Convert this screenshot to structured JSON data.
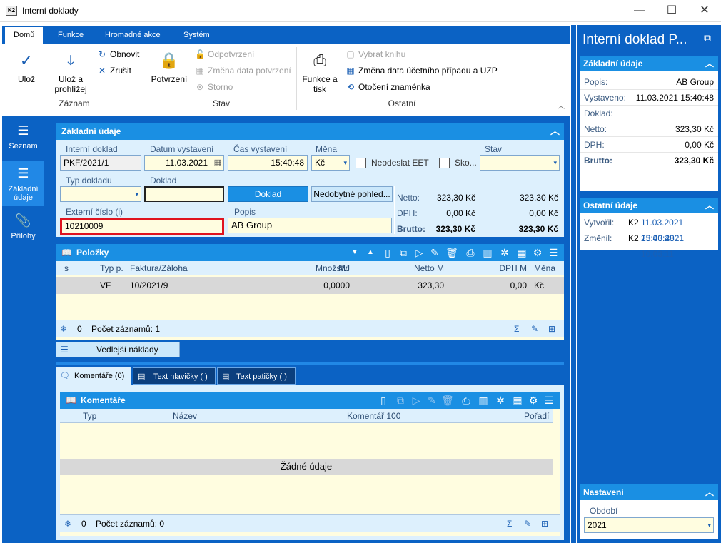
{
  "window": {
    "title": "Interní doklady",
    "icon_text": "K2"
  },
  "ribbon": {
    "tabs": [
      "Domů",
      "Funkce",
      "Hromadné akce",
      "Systém"
    ],
    "active_tab": "Domů",
    "zaznam": {
      "uloz": "Ulož",
      "uloz_prohlizej_1": "Ulož a",
      "uloz_prohlizej_2": "prohlížej",
      "obnovit": "Obnovit",
      "zrusit": "Zrušit",
      "label": "Záznam"
    },
    "stav": {
      "potvrzeni": "Potvrzení",
      "odpotvrzeni": "Odpotvrzení",
      "zmena_data": "Změna data potvrzení",
      "storno": "Storno",
      "label": "Stav"
    },
    "ostatni": {
      "funkce_tisk_1": "Funkce a",
      "funkce_tisk_2": "tisk",
      "vybrat_knihu": "Vybrat knihu",
      "zmena_data_uzp": "Změna data účetního případu a UZP",
      "otoceni": "Otočení znaménka",
      "label": "Ostatní"
    }
  },
  "leftnav": {
    "seznam": "Seznam",
    "zakladni_1": "Základní",
    "zakladni_2": "údaje",
    "prilohy": "Přílohy"
  },
  "basic": {
    "title": "Základní údaje",
    "interni_doklad_label": "Interní doklad",
    "interni_doklad": "PKF/2021/1",
    "datum_label": "Datum vystavení",
    "datum": "11.03.2021",
    "cas_label": "Čas vystavení",
    "cas": "15:40:48",
    "mena_label": "Měna",
    "mena": "Kč",
    "neodeslat": "Neodeslat EET",
    "sko": "Sko...",
    "stav_label": "Stav",
    "typ_label": "Typ dokladu",
    "doklad_label": "Doklad",
    "doklad_btn": "Doklad",
    "nedobytne_btn": "Nedobytné pohled...",
    "externi_label": "Externí číslo (i)",
    "externi": "10210009",
    "popis_label": "Popis",
    "popis": "AB Group",
    "netto_label": "Netto:",
    "netto1": "323,30 Kč",
    "netto2": "323,30 Kč",
    "dph_label": "DPH:",
    "dph1": "0,00 Kč",
    "dph2": "0,00 Kč",
    "brutto_label": "Brutto:",
    "brutto1": "323,30 Kč",
    "brutto2": "323,30 Kč"
  },
  "polozky": {
    "title": "Položky",
    "columns": [
      "s",
      "Typ p.",
      "Faktura/Záloha",
      "Množství",
      "MJ",
      "Netto M",
      "DPH M",
      "Měna"
    ],
    "row": {
      "typ": "VF",
      "faktura": "10/2021/9",
      "mnozstvi": "0,0000",
      "mj": "",
      "netto": "323,30",
      "dph": "0,00",
      "mena": "Kč"
    },
    "count_num": "0",
    "count_label": "Počet záznamů: 1"
  },
  "vedlejsi": "Vedlejší náklady",
  "tabs": [
    "Komentáře (0)",
    "Text hlavičky ( )",
    "Text patičky ( )"
  ],
  "komentare": {
    "title": "Komentáře",
    "columns": [
      "Typ",
      "Název",
      "Komentář 100",
      "Pořadí"
    ],
    "empty": "Žádné údaje",
    "count_num": "0",
    "count_label": "Počet záznamů: 0"
  },
  "right": {
    "title": "Interní doklad P...",
    "zakladni": {
      "title": "Základní údaje",
      "popis_k": "Popis:",
      "popis_v": "AB Group",
      "vystaveno_k": "Vystaveno:",
      "vystaveno_v": "11.03.2021 15:40:48",
      "doklad_k": "Doklad:",
      "netto_k": "Netto:",
      "netto_v": "323,30 Kč",
      "dph_k": "DPH:",
      "dph_v": "0,00 Kč",
      "brutto_k": "Brutto:",
      "brutto_v": "323,30 Kč"
    },
    "ostatni": {
      "title": "Ostatní údaje",
      "vytvoril_k": "Vytvořil:",
      "vytvoril_u": "K2",
      "vytvoril_d": "11.03.2021 15:40:48",
      "zmenil_k": "Změnil:",
      "zmenil_u": "K2",
      "zmenil_d": "23.03.2021 10:03:11"
    },
    "nastaveni": {
      "title": "Nastavení",
      "obdobi_label": "Období",
      "obdobi": "2021"
    }
  },
  "colors": {
    "accent": "#0b62c4",
    "header": "#1a8fe3",
    "highlight": "#e0141e"
  }
}
